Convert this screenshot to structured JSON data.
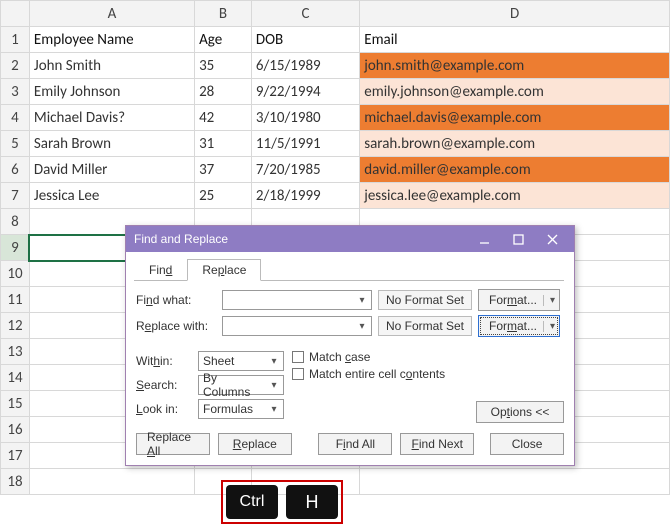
{
  "grid": {
    "cols": [
      "A",
      "B",
      "C",
      "D"
    ],
    "rows": [
      1,
      2,
      3,
      4,
      5,
      6,
      7,
      8,
      9,
      10,
      11,
      12,
      13,
      14,
      15,
      16,
      17,
      18
    ],
    "headers": {
      "A": "Employee Name",
      "B": "Age",
      "C": "DOB",
      "D": "Email"
    },
    "data": [
      {
        "name": "John Smith",
        "age": "35",
        "dob": "6/15/1989",
        "email": "john.smith@example.com"
      },
      {
        "name": "Emily Johnson",
        "age": "28",
        "dob": "9/22/1994",
        "email": "emily.johnson@example.com"
      },
      {
        "name": "Michael Davis?",
        "age": "42",
        "dob": "3/10/1980",
        "email": "michael.davis@example.com"
      },
      {
        "name": "Sarah Brown",
        "age": "31",
        "dob": "11/5/1991",
        "email": "sarah.brown@example.com"
      },
      {
        "name": "David Miller",
        "age": "37",
        "dob": "7/20/1985",
        "email": "david.miller@example.com"
      },
      {
        "name": "Jessica Lee",
        "age": "25",
        "dob": "2/18/1999",
        "email": "jessica.lee@example.com"
      }
    ],
    "selected_cell": "A9"
  },
  "dialog": {
    "title": "Find and Replace",
    "tabs": {
      "find": "Find",
      "replace": "Replace",
      "active": "replace"
    },
    "find_label": "Find what:",
    "replace_label": "Replace with:",
    "find_value": "",
    "replace_value": "",
    "no_format": "No Format Set",
    "format_btn": "Format...",
    "within_label": "Within:",
    "within_value": "Sheet",
    "search_label": "Search:",
    "search_value": "By Columns",
    "lookin_label": "Look in:",
    "lookin_value": "Formulas",
    "match_case": "Match case",
    "match_entire": "Match entire cell contents",
    "options_btn": "Options <<",
    "footer": {
      "replace_all": "Replace All",
      "replace": "Replace",
      "find_all": "Find All",
      "find_next": "Find Next",
      "close": "Close"
    }
  },
  "keys": {
    "ctrl": "Ctrl",
    "h": "H"
  }
}
